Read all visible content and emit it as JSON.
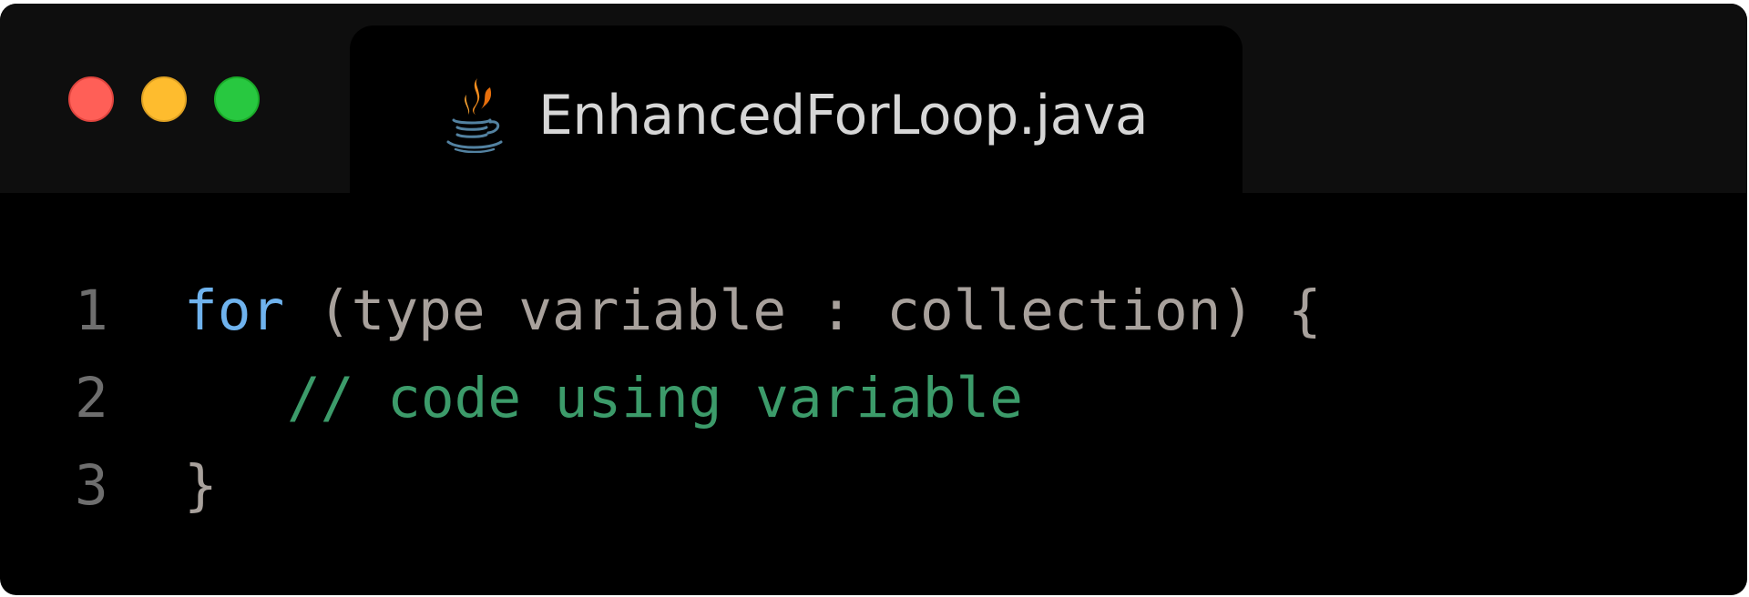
{
  "window": {
    "controls": {
      "close": "red-circle",
      "minimize": "yellow-circle",
      "maximize": "green-circle"
    },
    "tab": {
      "icon": "java-coffee-cup-icon",
      "title": "EnhancedForLoop.java"
    }
  },
  "editor": {
    "lines": [
      {
        "number": "1",
        "keyword": "for",
        "rest": " (type variable : collection) {"
      },
      {
        "number": "2",
        "comment": "// code using variable"
      },
      {
        "number": "3",
        "text": "}"
      }
    ]
  },
  "colors": {
    "background": "#000000",
    "titlebar": "#0e0e0e",
    "keyword": "#6fb3ee",
    "plain": "#a8a19c",
    "comment": "#3c9b6a",
    "line_number": "#6e6e6e",
    "tab_title": "#d6d6d6"
  }
}
